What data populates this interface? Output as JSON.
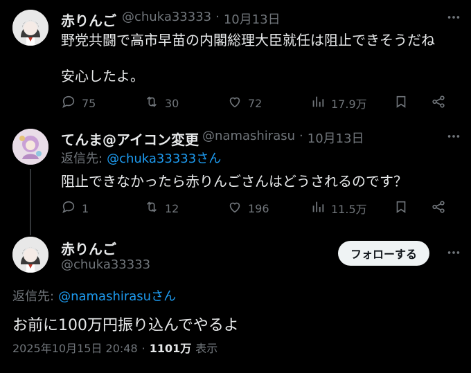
{
  "tweet1": {
    "name": "赤りんご",
    "handle": "@chuka33333",
    "date": "10月13日",
    "line1": "野党共闘で高市早苗の内閣総理大臣就任は阻止できそうだね",
    "line2": "安心したよ。",
    "replies": "75",
    "retweets": "30",
    "likes": "72",
    "views": "17.9万"
  },
  "tweet2": {
    "name": "てんま@アイコン変更",
    "handle": "@namashirasu",
    "date": "10月13日",
    "reply_prefix": "返信先:",
    "reply_to": "@chuka33333さん",
    "text": "阻止できなかったら赤りんごさんはどうされるのです？",
    "replies": "1",
    "retweets": "12",
    "likes": "196",
    "views": "11.5万"
  },
  "tweet3": {
    "name": "赤りんご",
    "handle": "@chuka33333",
    "follow_label": "フォローする",
    "reply_prefix": "返信先:",
    "reply_to": "@namashirasuさん",
    "text": "お前に100万円振り込んでやるよ",
    "timestamp": "2025年10月15日 20:48",
    "views_count": "1101万",
    "views_label": "表示"
  },
  "separator": "·"
}
